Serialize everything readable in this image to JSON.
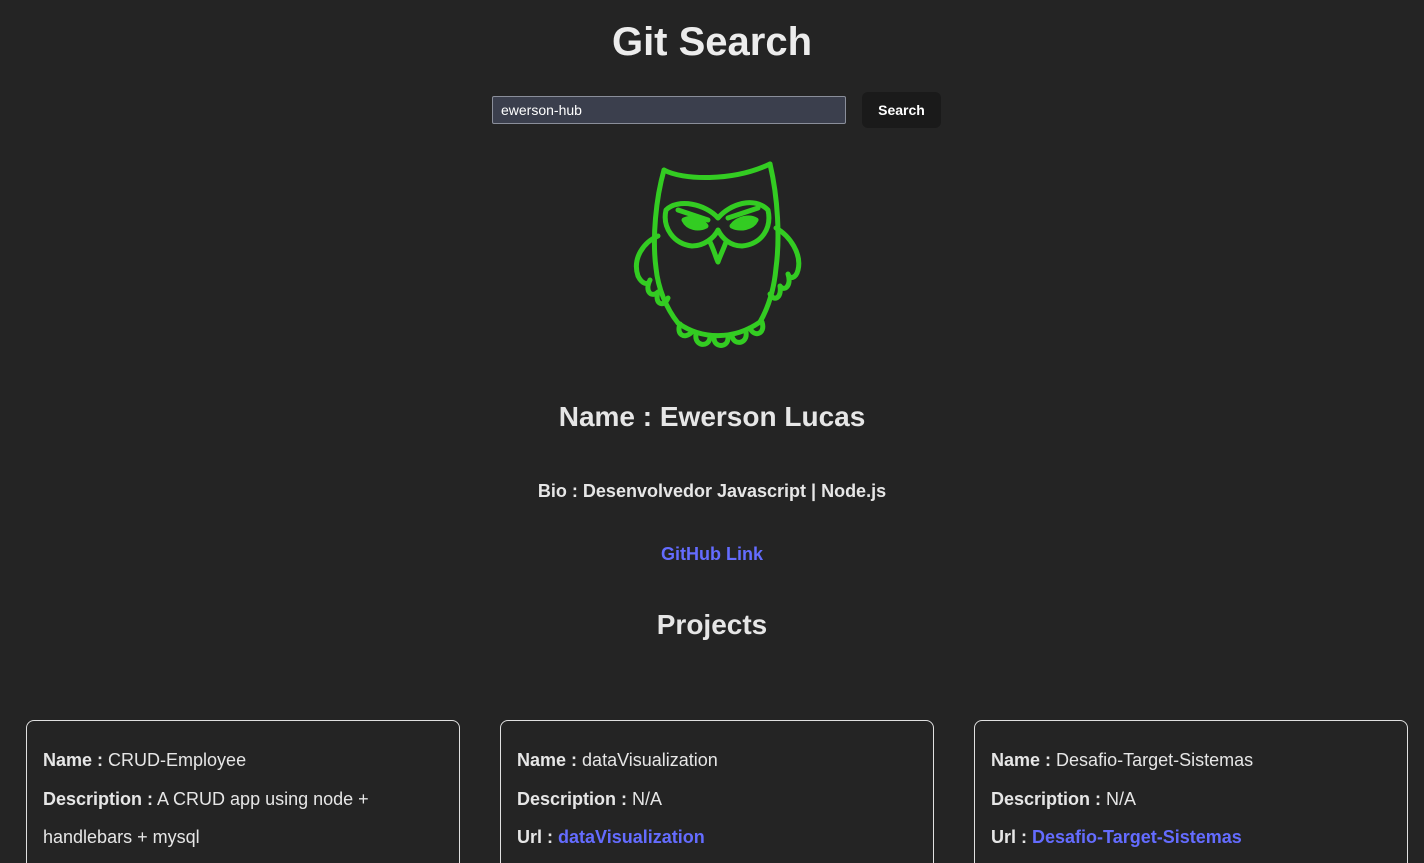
{
  "header": {
    "title": "Git Search"
  },
  "search": {
    "value": "ewerson-hub",
    "button_label": "Search"
  },
  "profile": {
    "avatar_icon": "owl-icon",
    "avatar_color": "#33cc22",
    "name_label": "Name :",
    "name": "Ewerson Lucas",
    "bio_label": "Bio :",
    "bio": "Desenvolvedor Javascript | Node.js",
    "link_label": "GitHub Link"
  },
  "projects": {
    "heading": "Projects",
    "labels": {
      "name": "Name :",
      "description": "Description :",
      "url": "Url :"
    },
    "items": [
      {
        "name": "CRUD-Employee",
        "description": "A CRUD app using node + handlebars + mysql"
      },
      {
        "name": "dataVisualization",
        "description": "N/A",
        "url_text": "dataVisualization"
      },
      {
        "name": "Desafio-Target-Sistemas",
        "description": "N/A",
        "url_text": "Desafio-Target-Sistemas"
      }
    ]
  },
  "colors": {
    "background": "#242424",
    "link": "#646cff",
    "button_bg": "#1a1a1a"
  }
}
